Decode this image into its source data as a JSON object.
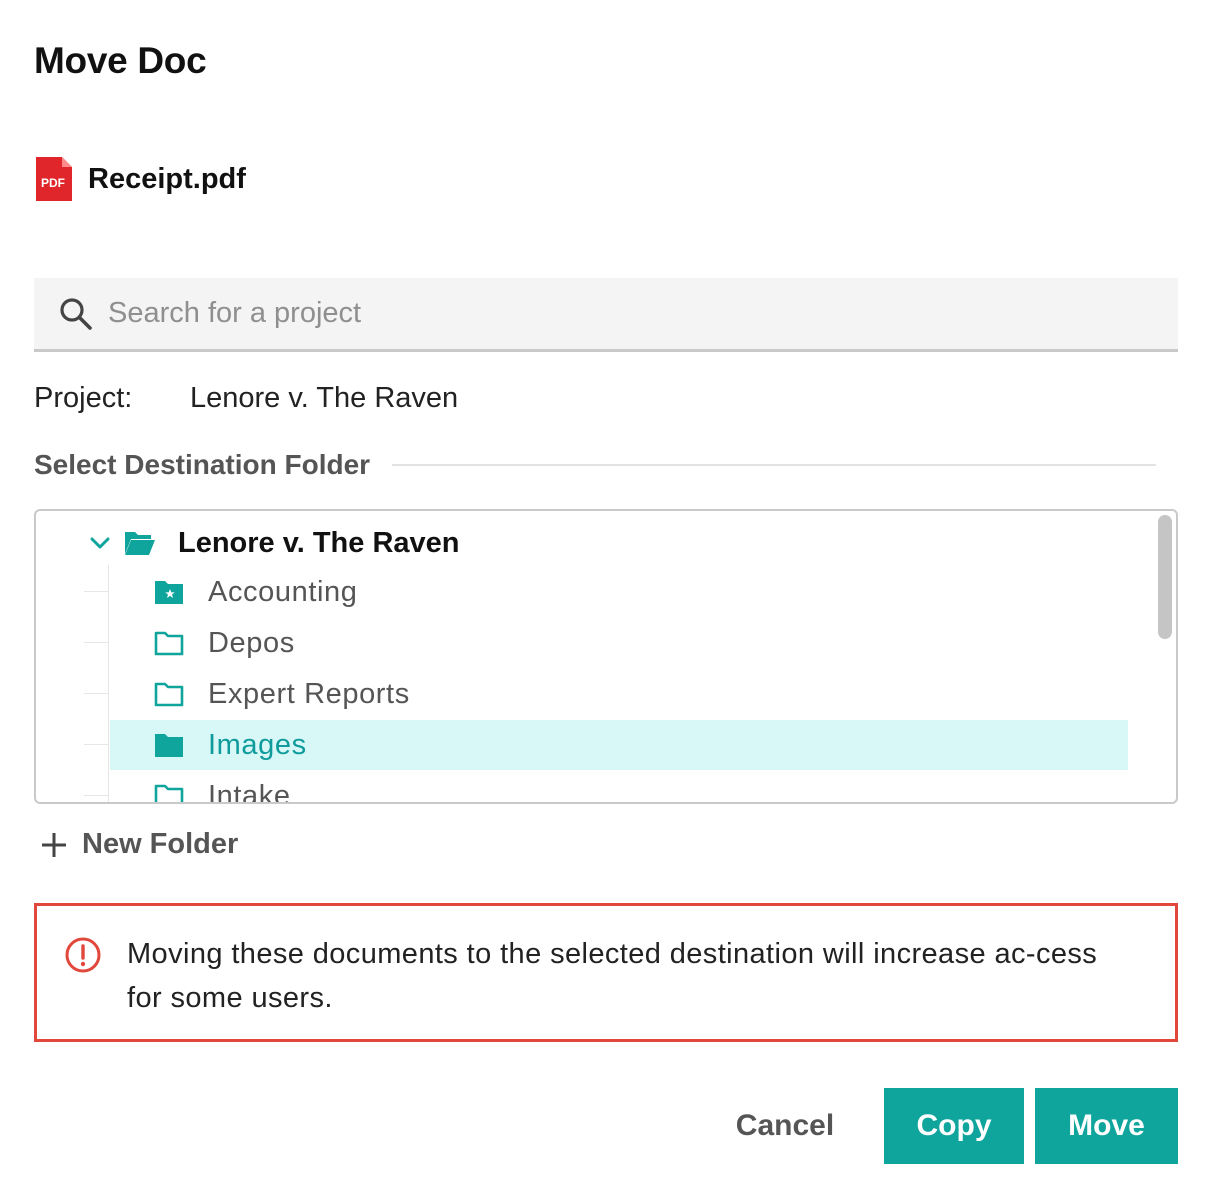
{
  "dialog": {
    "title": "Move Doc"
  },
  "file": {
    "name": "Receipt.pdf",
    "icon": "pdf-file-icon",
    "icon_text": "PDF",
    "icon_color": "#e0262b"
  },
  "search": {
    "placeholder": "Search for a project",
    "value": ""
  },
  "project": {
    "label": "Project:",
    "value": "Lenore v. The Raven"
  },
  "destination": {
    "section_label": "Select Destination Folder",
    "root": {
      "label": "Lenore v. The Raven",
      "icon": "folder-open-icon",
      "expanded": true
    },
    "folders": [
      {
        "label": "Accounting",
        "icon": "starred-folder-icon",
        "selected": false
      },
      {
        "label": "Depos",
        "icon": "folder-icon",
        "selected": false
      },
      {
        "label": "Expert Reports",
        "icon": "folder-icon",
        "selected": false
      },
      {
        "label": "Images",
        "icon": "folder-filled-icon",
        "selected": true
      },
      {
        "label": "Intake",
        "icon": "folder-icon",
        "selected": false
      }
    ]
  },
  "new_folder": {
    "label": "New Folder"
  },
  "warning": {
    "text": "Moving these documents to the selected destination will increase ac-cess for some users.",
    "color": "#e2473c"
  },
  "buttons": {
    "cancel": "Cancel",
    "copy": "Copy",
    "move": "Move"
  },
  "colors": {
    "accent": "#0fa49c",
    "selected_bg": "#d8f8f8"
  }
}
